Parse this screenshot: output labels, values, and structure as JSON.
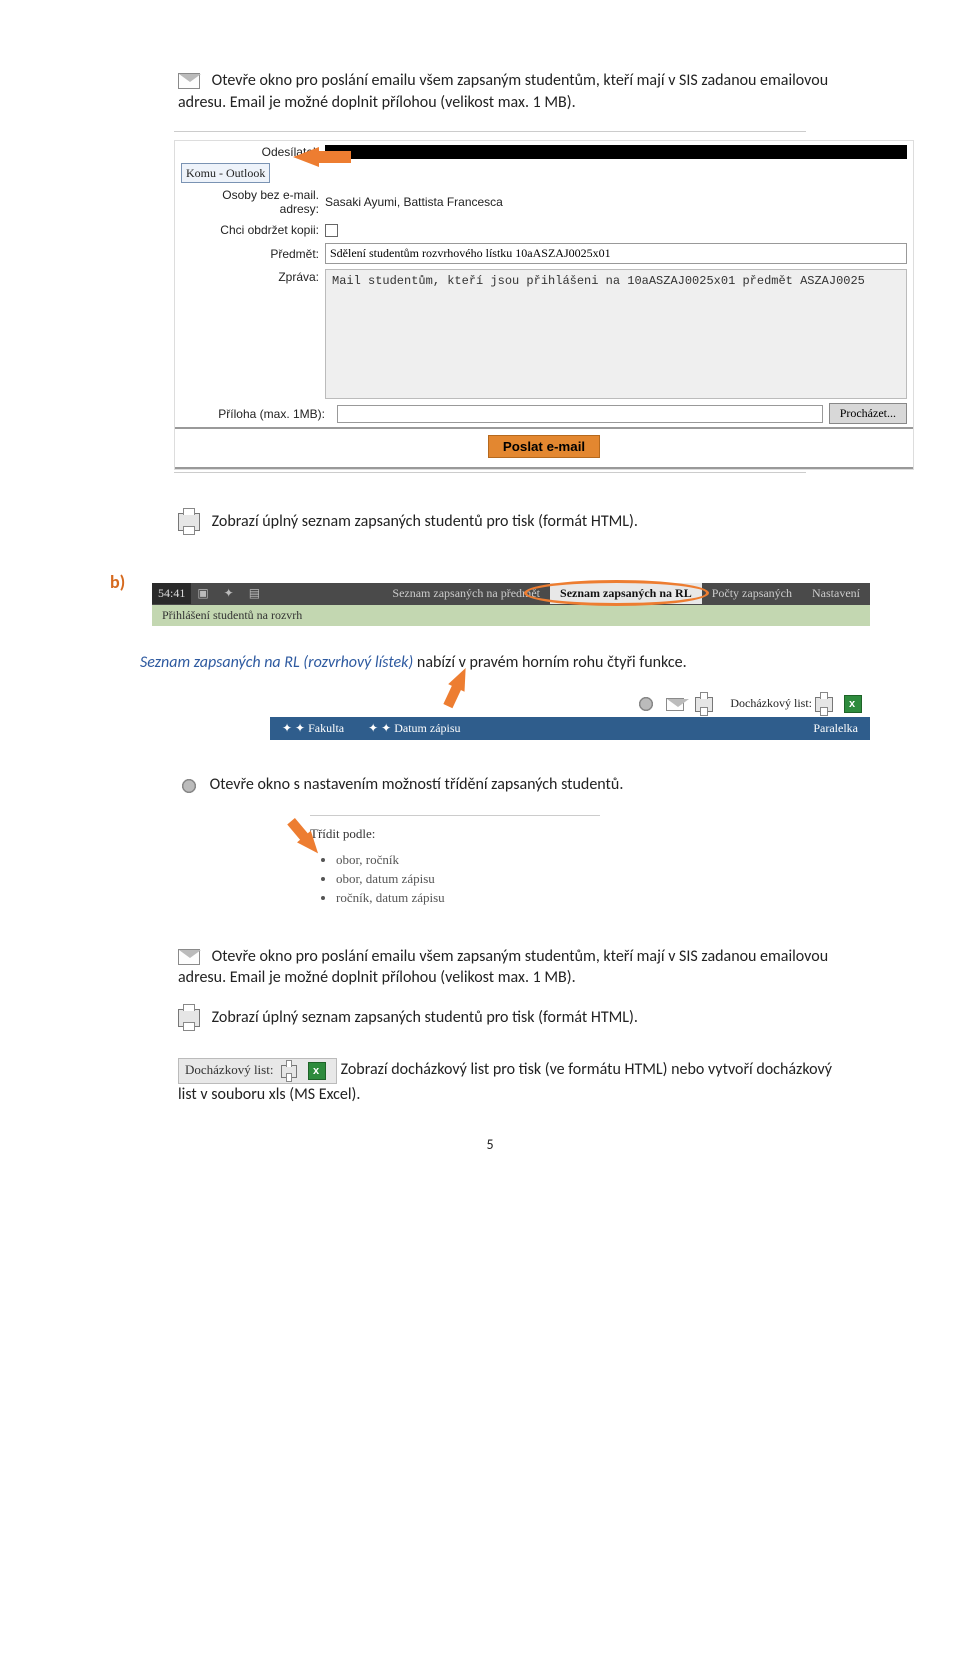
{
  "p1": " Otevře okno pro poslání emailu všem zapsaným studentům, kteří mají v SIS zadanou emailovou adresu. Email je možné doplnit přílohou (velikost max. 1 MB).",
  "form": {
    "lbl_sender": "Odesílatel:",
    "lbl_to": "Komu - Outlook",
    "lbl_noemail": "Osoby bez e-mail. adresy:",
    "noemail_val": "Sasaki Ayumi, Battista Francesca",
    "lbl_cc": "Chci obdržet kopii:",
    "lbl_subject": "Předmět:",
    "subject_val": "Sdělení studentům rozvrhového lístku 10aASZAJ0025x01",
    "lbl_msg": "Zpráva:",
    "msg_val": "Mail studentům, kteří jsou přihlášeni na 10aASZAJ0025x01 předmět ASZAJ0025",
    "lbl_attach": "Příloha (max. 1MB):",
    "btn_browse": "Procházet...",
    "btn_send": "Poslat e-mail"
  },
  "p2": " Zobrazí úplný seznam zapsaných studentů pro tisk (formát HTML).",
  "b_label": "b)",
  "tabbar": {
    "time": "54:41",
    "t1": "Seznam zapsaných na předmět",
    "t2": "Seznam zapsaných na RL",
    "t3": "Počty zapsaných",
    "t4": "Nastavení",
    "sub": "Přihlášení studentů na rozvrh"
  },
  "p3_pre": "Seznam zapsaných na RL (rozvrhový lístek) ",
  "p3_post": "nabízí v pravém horním rohu  čtyři  funkce.",
  "bluebar": {
    "icon_lbl": "Docházkový list:",
    "c1": "✦ ✦ Fakulta",
    "c2": "✦ ✦ Datum zápisu",
    "c3": "Paralelka"
  },
  "p4": " Otevře okno s nastavením možností třídění zapsaných studentů.",
  "sort": {
    "title": "Třídit podle:",
    "opt1": "obor, ročník",
    "opt2": "obor, datum zápisu",
    "opt3": "ročník, datum zápisu"
  },
  "p5": " Otevře okno pro poslání emailu všem zapsaným studentům, kteří mají v SIS zadanou emailovou adresu. Email je možné doplnit přílohou (velikost max. 1 MB).",
  "p6": " Zobrazí úplný seznam zapsaných studentů pro tisk (formát HTML).",
  "doch_label": "Docházkový list:",
  "p7": " Zobrazí docházkový list pro tisk (ve formátu HTML) nebo vytvoří docházkový list v souboru xls (MS Excel).",
  "page_num": "5"
}
